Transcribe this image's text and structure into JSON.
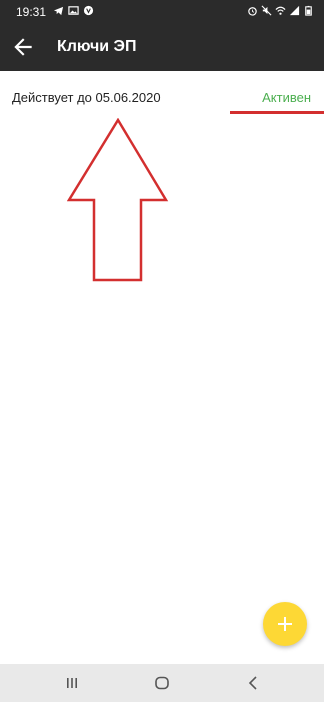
{
  "status_bar": {
    "time": "19:31",
    "left_icons": [
      "telegram-icon",
      "image-icon",
      "vk-icon"
    ],
    "right_icons": [
      "alarm-icon",
      "mute-icon",
      "wifi-icon",
      "signal-icon",
      "battery-icon"
    ]
  },
  "app_bar": {
    "title": "Ключи ЭП",
    "back_icon": "arrow-left-icon"
  },
  "list": {
    "items": [
      {
        "text": "Действует до 05.06.2020",
        "status": "Активен",
        "status_color": "#4caf50"
      }
    ]
  },
  "annotation": {
    "color": "#d32f2f"
  },
  "fab": {
    "icon": "plus-icon",
    "color": "#fdd835"
  },
  "nav_bar": {
    "buttons": [
      "recent-apps-icon",
      "home-icon",
      "back-icon"
    ]
  }
}
